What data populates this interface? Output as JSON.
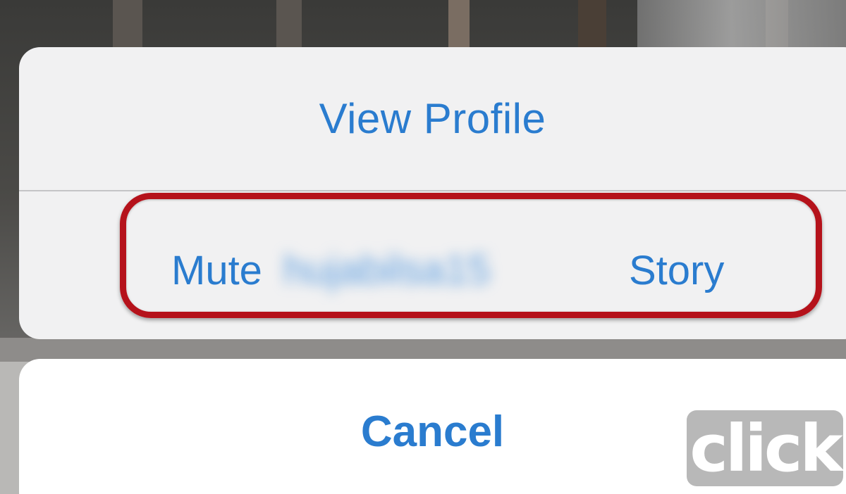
{
  "action_sheet": {
    "view_profile_label": "View Profile",
    "mute_prefix": "Mute",
    "mute_username": "hujabilsa15",
    "mute_suffix": "Story"
  },
  "cancel_sheet": {
    "cancel_label": "Cancel"
  },
  "watermark": {
    "text": "click"
  },
  "colors": {
    "ios_blue": "#2a7ccf",
    "highlight_red": "#b5121b",
    "sheet_bg": "#f1f1f2"
  }
}
